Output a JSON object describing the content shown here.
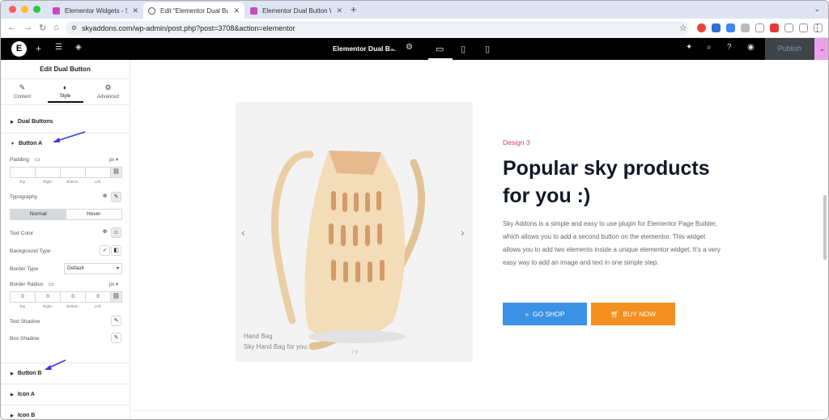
{
  "browser": {
    "tabs": [
      {
        "title": "Elementor Widgets - Sky Addons",
        "favicon_color": "#c54ac5"
      },
      {
        "title": "Edit “Elementor Dual Button Widget",
        "favicon_color": "#444444"
      },
      {
        "title": "Elementor Dual Button Widget",
        "favicon_color": "#c54ac5"
      }
    ],
    "url": "skyaddons.com/wp-admin/post.php?post=3708&action=elementor"
  },
  "editor": {
    "doc_title": "Elementor Dual B...",
    "publish_label": "Publish"
  },
  "panel": {
    "title": "Edit Dual Button",
    "tabs": [
      {
        "label": "Content",
        "icon": "pencil-icon"
      },
      {
        "label": "Style",
        "icon": "contrast-icon"
      },
      {
        "label": "Advanced",
        "icon": "gear-icon"
      }
    ],
    "sections": {
      "dual_buttons": "Dual Buttons",
      "button_a": "Button A",
      "button_b": "Button B",
      "icon_a": "Icon A",
      "icon_b": "Icon B"
    },
    "padding": {
      "label": "Padding",
      "unit": "px",
      "values": [
        "",
        "",
        "",
        ""
      ],
      "sides": [
        "Top",
        "Right",
        "Bottom",
        "Left"
      ]
    },
    "typography_label": "Typography",
    "state_tabs": [
      "Normal",
      "Hover"
    ],
    "text_color_label": "Text Color",
    "background_type_label": "Background Type",
    "border_type": {
      "label": "Border Type",
      "value": "Default"
    },
    "border_radius": {
      "label": "Border Radius",
      "unit": "px",
      "values": [
        "0",
        "0",
        "0",
        "0"
      ],
      "sides": [
        "Top",
        "Right",
        "Bottom",
        "Left"
      ]
    },
    "text_shadow_label": "Text Shadow",
    "box_shadow_label": "Box Shadow"
  },
  "preview": {
    "eyebrow": "Design 3",
    "heading": "Popular sky products for you :)",
    "description": "Sky Addons is a simple and easy to use plugin for Elementor Page Builder, which allows you to add a second button on the elementor. This widget allows you to add two elements inside a unique elementor widget. It’s a very easy way to add an image and text in one simple step.",
    "image_title": "Hand Bag",
    "image_caption": "Sky Hand Bag for you.",
    "slide_counter": "/ 3",
    "button_a": {
      "label": "GO SHOP",
      "color": "#3b91e6"
    },
    "button_b": {
      "label": "BUY NOW",
      "color": "#f28f1e"
    }
  }
}
